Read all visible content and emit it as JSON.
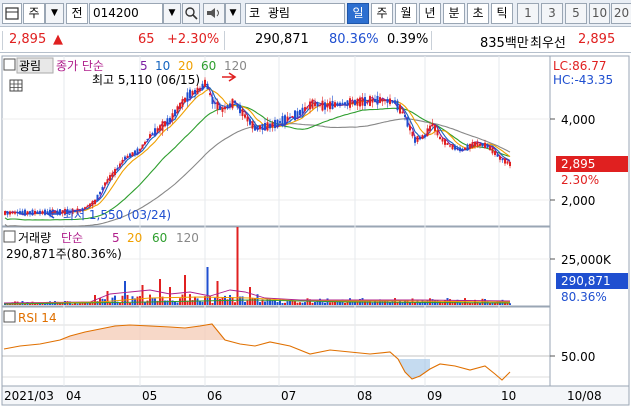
{
  "toolbar": {
    "market_select": "주",
    "market_arrow": "▼",
    "type_label": "전",
    "code_value": "014200",
    "exchange_label": "코",
    "stock_name": "광림",
    "period_tabs": [
      "일",
      "주",
      "월",
      "년",
      "분",
      "초",
      "틱"
    ],
    "active_tab": "일",
    "interval_buttons": [
      "1",
      "3",
      "5",
      "10",
      "20"
    ]
  },
  "quote": {
    "price": "2,895",
    "change_arrow": "▲",
    "change": "65",
    "change_pct": "+2.30%",
    "volume": "290,871",
    "volume_ratio": "80.36%",
    "turnover": "0.39%",
    "amount": "835백만",
    "pref_label": "최우선",
    "pref_price": "2,895"
  },
  "price_panel": {
    "stock_tag": "광림",
    "ma_label": "종가 단순",
    "ma_periods": [
      "5",
      "10",
      "20",
      "60",
      "120"
    ],
    "ma_colors": [
      "#7b1fa2",
      "#1565c0",
      "#f0a000",
      "#2e9e2e",
      "#888888"
    ],
    "high_annotation": "최고 5,110 (06/15)",
    "low_annotation": "최저 1,550 (03/24)",
    "lc": "LC:86.77",
    "hc": "HC:-43.35",
    "y_ticks": [
      "4,000",
      "2,000"
    ],
    "last_price_tag": "2,895",
    "last_pct_tag": "2.30%"
  },
  "volume_panel": {
    "title": "거래량",
    "ma_label": "단순",
    "ma_periods": [
      "5",
      "20",
      "60",
      "120"
    ],
    "sub_label": "290,871주(80.36%)",
    "y_tick": "25,000K",
    "last_value_tag": "290,871",
    "last_pct_tag": "80.36%"
  },
  "rsi_panel": {
    "title": "RSI 14",
    "y_tick": "50.00"
  },
  "x_axis": {
    "labels": [
      "2021/03",
      "04",
      "05",
      "06",
      "07",
      "08",
      "09",
      "10"
    ],
    "right_date": "10/08"
  },
  "colors": {
    "up": "#e02020",
    "down": "#1f4fd0",
    "tab_active": "#2d6fd0",
    "label_magenta": "#b0208c"
  }
}
